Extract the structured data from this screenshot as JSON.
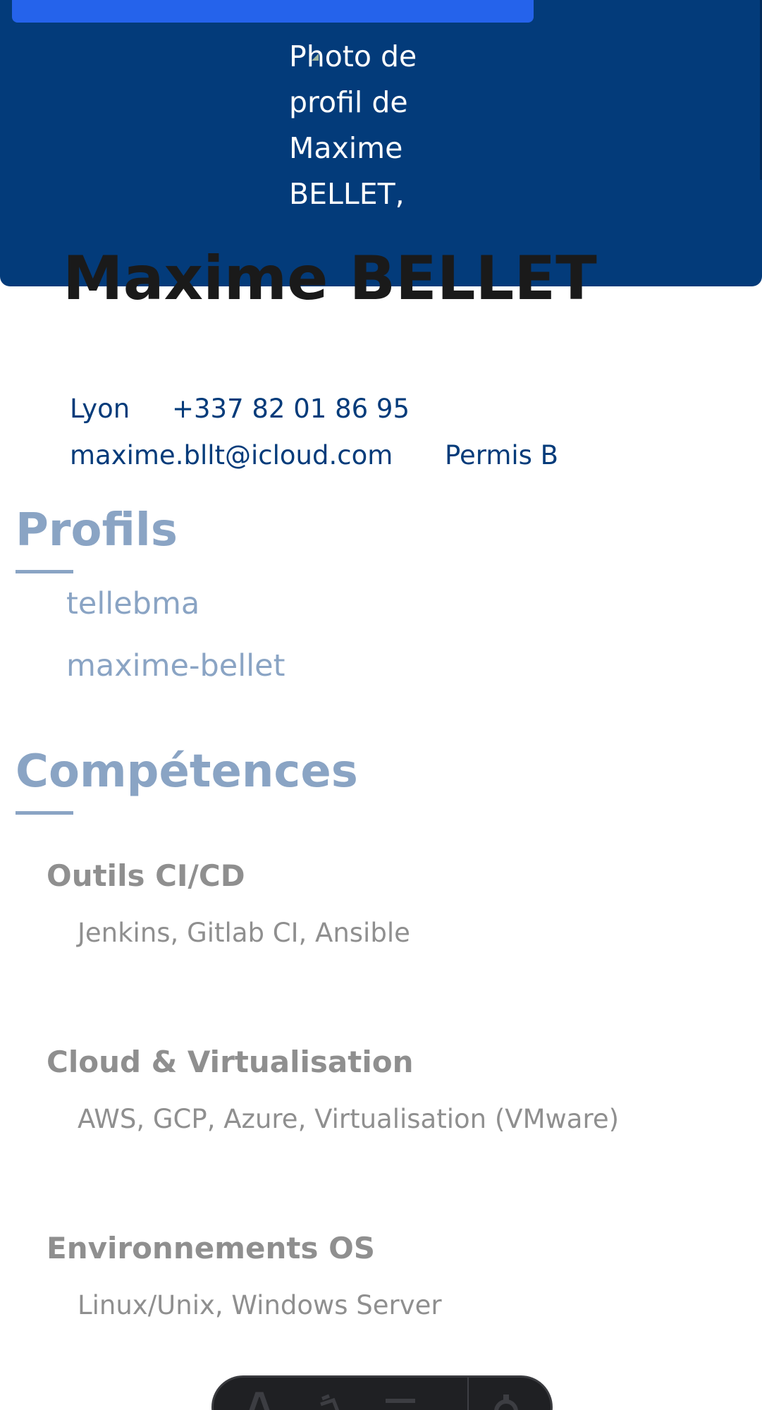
{
  "header": {
    "photo_alt": "Photo de profil de Maxime BELLET,",
    "name": "Maxime BELLET"
  },
  "contact": {
    "city": "Lyon",
    "phone": "+337 82 01 86 95",
    "email": "maxime.bllt@icloud.com",
    "license": "Permis B"
  },
  "profiles": {
    "title": "Profils",
    "links": [
      "tellebma",
      "maxime-bellet"
    ]
  },
  "skills": {
    "title": "Compétences",
    "categories": [
      {
        "name": "Outils CI/CD",
        "items": "Jenkins, Gitlab CI, Ansible"
      },
      {
        "name": "Cloud & Virtualisation",
        "items": "AWS, GCP, Azure, Virtualisation (VMware)"
      },
      {
        "name": "Environnements OS",
        "items": "Linux/Unix, Windows Server"
      }
    ]
  },
  "toolbar": {
    "icons": [
      "text-size-icon",
      "clean-icon",
      "menu-icon",
      "settings-icon"
    ]
  },
  "colors": {
    "header_bg": "#033b7a",
    "top_bar": "#2563eb",
    "contact_text": "#033b7a",
    "section_title": "#8aa4c4",
    "skill_text": "#8f8f8f",
    "toolbar_bg": "#1f2023"
  }
}
